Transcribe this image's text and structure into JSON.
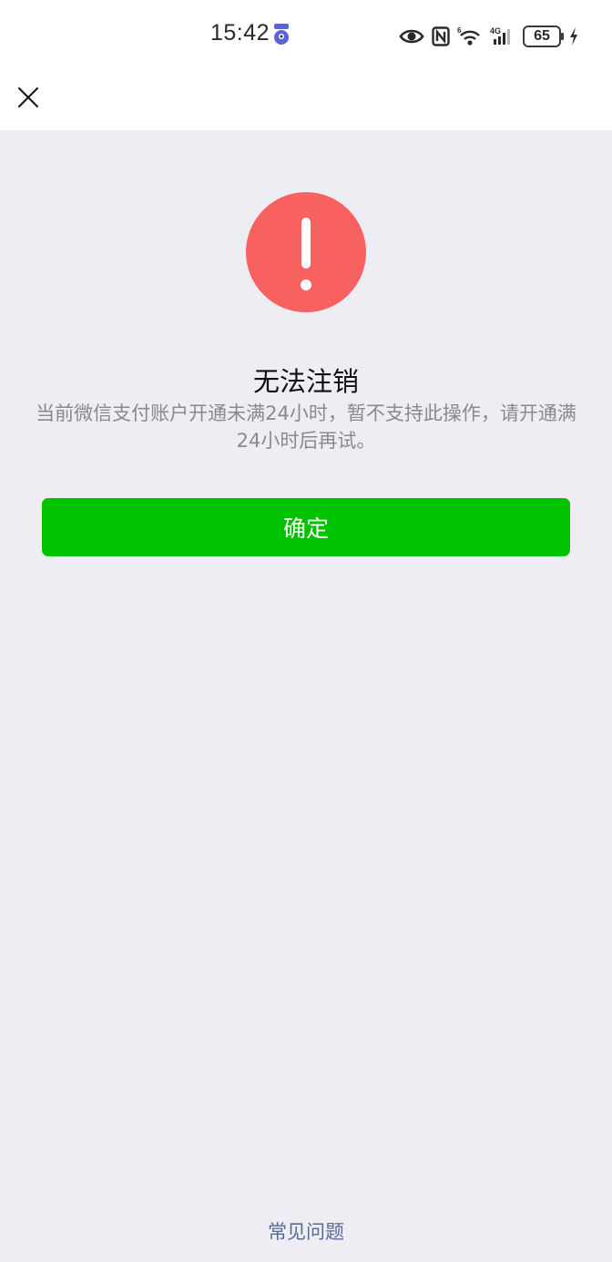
{
  "status_bar": {
    "time": "15:42",
    "app_icon": "app-notification-icon",
    "icons": [
      "eye-icon",
      "nfc-icon",
      "wifi-6-icon",
      "signal-4g-icon",
      "battery-icon",
      "charging-icon"
    ],
    "battery_level": "65"
  },
  "nav": {
    "close_icon": "close-icon"
  },
  "result": {
    "icon": "warning-icon",
    "icon_color": "#f76260",
    "title": "无法注销",
    "description": "当前微信支付账户开通未满24小时，暂不支持此操作，请开通满24小时后再试。"
  },
  "actions": {
    "confirm_label": "确定",
    "confirm_color": "#00c200"
  },
  "footer": {
    "faq_label": "常见问题",
    "faq_color": "#576b95"
  }
}
